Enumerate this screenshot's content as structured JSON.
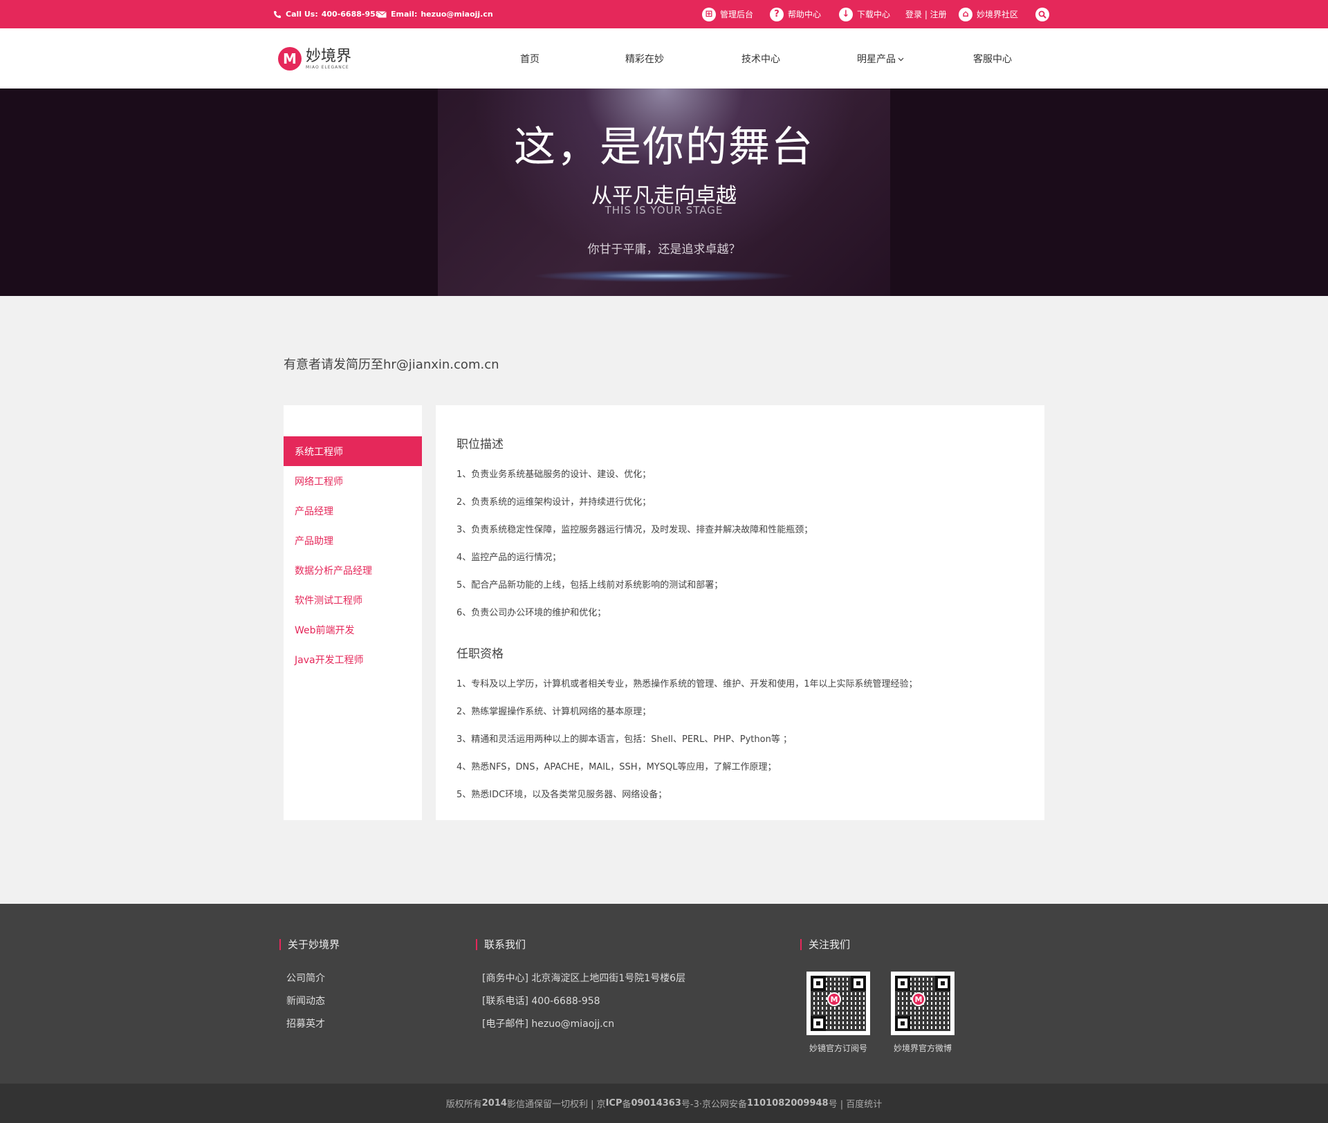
{
  "topbar": {
    "call_label": "Call Us:",
    "phone": "400-6688-958",
    "email_label": "Email:",
    "email": "hezuo@miaojj.cn",
    "links": [
      "管理后台",
      "帮助中心",
      "下载中心",
      "登录 | 注册",
      "妙境界社区"
    ]
  },
  "header": {
    "logo_cn": "妙境界",
    "logo_en": "MIAO ELEGANCE",
    "nav": [
      "首页",
      "精彩在妙",
      "技术中心",
      "明星产品",
      "客服中心"
    ],
    "nav_dropdown_icon": "chevron-down-icon"
  },
  "banner": {
    "title": "这，是你的舞台",
    "subtitle": "从平凡走向卓越",
    "english": "THIS IS YOUR STAGE",
    "question": "你甘于平庸，还是追求卓越？"
  },
  "notice": "有意者请发简历至hr@jianxin.com.cn",
  "sidebar": {
    "items": [
      "系统工程师",
      "网络工程师",
      "产品经理",
      "产品助理",
      "数据分析产品经理",
      "软件测试工程师",
      "Web前端开发",
      "Java开发工程师"
    ],
    "active": "系统工程师"
  },
  "job": {
    "desc_title": "职位描述",
    "desc": [
      "1、负责业务系统基础服务的设计、建设、优化；",
      "2、负责系统的运维架构设计，并持续进行优化；",
      "3、负责系统稳定性保障，监控服务器运行情况，及时发现、排查并解决故障和性能瓶颈；",
      "4、监控产品的运行情况；",
      "5、配合产品新功能的上线，包括上线前对系统影响的测试和部署；",
      "6、负责公司办公环境的维护和优化；"
    ],
    "req_title": "任职资格",
    "req": [
      "1、专科及以上学历，计算机或者相关专业，熟悉操作系统的管理、维护、开发和使用，1年以上实际系统管理经验；",
      "2、熟练掌握操作系统、计算机网络的基本原理；",
      "3、精通和灵活运用两种以上的脚本语言，包括：Shell、PERL、PHP、Python等 ；",
      "4、熟悉NFS，DNS，APACHE，MAIL，SSH，MYSQL等应用，了解工作原理；",
      "5、熟悉IDC环境，以及各类常见服务器、网络设备；"
    ]
  },
  "footer": {
    "about_title": "关于妙境界",
    "about_links": [
      "公司简介",
      "新闻动态",
      "招募英才"
    ],
    "contact_title": "联系我们",
    "contact_lines": [
      "[商务中心] 北京海淀区上地四街1号院1号楼6层",
      "[联系电话] 400-6688-958",
      "[电子邮件] hezuo@miaojj.cn"
    ],
    "follow_title": "关注我们",
    "qr_captions": [
      "妙镜官方订阅号",
      "妙境界官方微博"
    ],
    "copyright_parts": [
      "版权所有",
      "2014",
      "影信通保留一切权利 | 京",
      "ICP",
      "备",
      "09014363",
      "号-3·京公网安备",
      "1101082009948",
      "号 | 百度统计"
    ]
  },
  "colors": {
    "accent": "#e5285a",
    "footer_bg": "#424242",
    "copyright_bg": "#333333",
    "banner_bg": "#1b0c1a"
  }
}
